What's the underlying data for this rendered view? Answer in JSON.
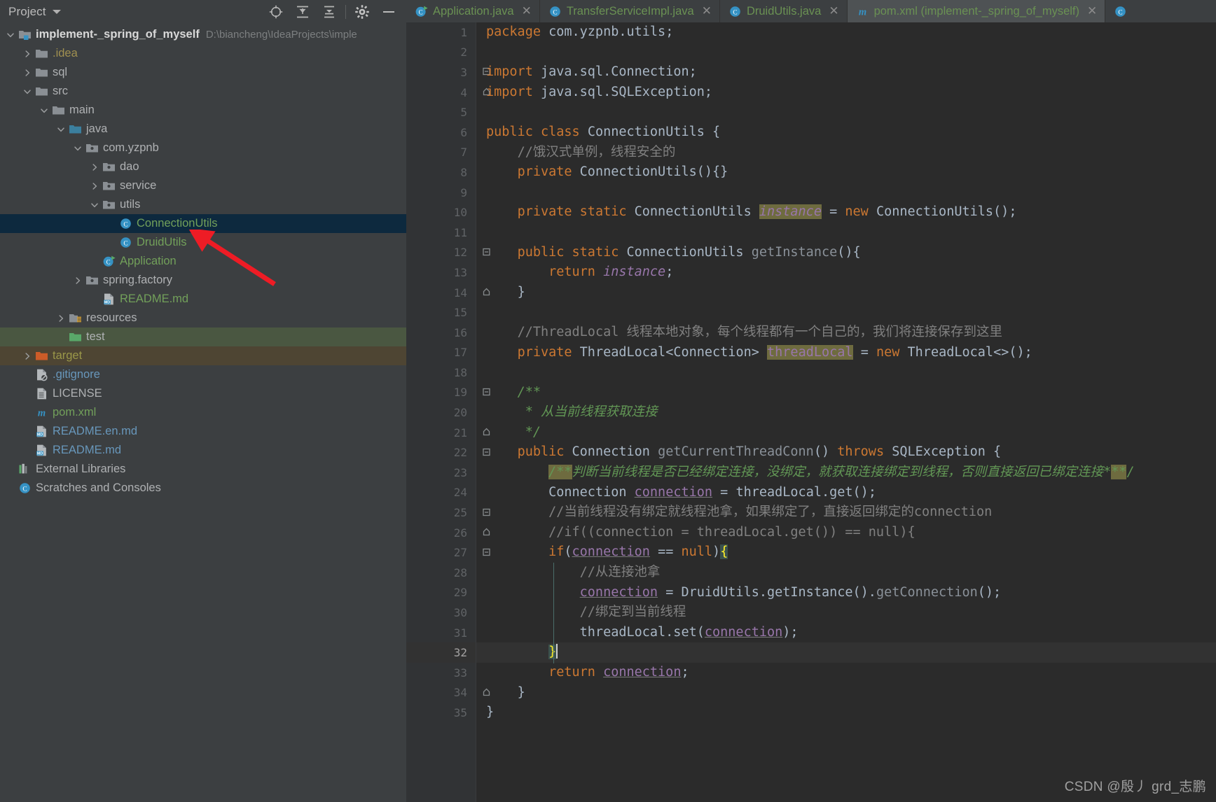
{
  "toolwindow": {
    "title": "Project",
    "actions": [
      {
        "name": "locate-icon",
        "tip": "Select Opened File"
      },
      {
        "name": "expand-all-icon",
        "tip": "Expand All"
      },
      {
        "name": "collapse-all-icon",
        "tip": "Collapse All"
      },
      {
        "name": "gear-icon",
        "tip": "Settings"
      },
      {
        "name": "minimize-icon",
        "tip": "Hide"
      }
    ]
  },
  "tree": [
    {
      "label": "implement-_spring_of_myself",
      "path": "D:\\biancheng\\IdeaProjects\\imple",
      "indent": 0,
      "arrow": "down",
      "icon": "module-icon",
      "color": "bold",
      "state": "normal"
    },
    {
      "label": ".idea",
      "indent": 1,
      "arrow": "right",
      "icon": "folder-icon",
      "color": "yellow",
      "state": "normal"
    },
    {
      "label": "sql",
      "indent": 1,
      "arrow": "right",
      "icon": "folder-icon",
      "color": "grey",
      "state": "normal"
    },
    {
      "label": "src",
      "indent": 1,
      "arrow": "down",
      "icon": "folder-icon",
      "color": "grey",
      "state": "normal"
    },
    {
      "label": "main",
      "indent": 2,
      "arrow": "down",
      "icon": "folder-icon",
      "color": "grey",
      "state": "normal"
    },
    {
      "label": "java",
      "indent": 3,
      "arrow": "down",
      "icon": "source-folder-icon",
      "color": "grey",
      "state": "normal"
    },
    {
      "label": "com.yzpnb",
      "indent": 4,
      "arrow": "down",
      "icon": "package-icon",
      "color": "grey",
      "state": "normal"
    },
    {
      "label": "dao",
      "indent": 5,
      "arrow": "right",
      "icon": "package-icon",
      "color": "grey",
      "state": "normal"
    },
    {
      "label": "service",
      "indent": 5,
      "arrow": "right",
      "icon": "package-icon",
      "color": "grey",
      "state": "normal"
    },
    {
      "label": "utils",
      "indent": 5,
      "arrow": "down",
      "icon": "package-icon",
      "color": "grey",
      "state": "normal"
    },
    {
      "label": "ConnectionUtils",
      "indent": 6,
      "arrow": "none",
      "icon": "java-class-icon",
      "color": "green",
      "state": "selected"
    },
    {
      "label": "DruidUtils",
      "indent": 6,
      "arrow": "none",
      "icon": "java-class-icon",
      "color": "green",
      "state": "normal"
    },
    {
      "label": "Application",
      "indent": 5,
      "arrow": "none",
      "icon": "java-runnable-class-icon",
      "color": "green",
      "state": "normal"
    },
    {
      "label": "spring.factory",
      "indent": 4,
      "arrow": "right",
      "icon": "package-icon",
      "color": "grey",
      "state": "normal"
    },
    {
      "label": "README.md",
      "indent": 5,
      "arrow": "none",
      "icon": "markdown-icon",
      "color": "green",
      "state": "normal"
    },
    {
      "label": "resources",
      "indent": 3,
      "arrow": "right",
      "icon": "resources-folder-icon",
      "color": "grey",
      "state": "normal"
    },
    {
      "label": "test",
      "indent": 3,
      "arrow": "none",
      "icon": "test-folder-icon",
      "color": "grey",
      "state": "green-bg"
    },
    {
      "label": "target",
      "indent": 1,
      "arrow": "right",
      "icon": "excluded-folder-icon",
      "color": "olive",
      "state": "brown-bg"
    },
    {
      "label": ".gitignore",
      "indent": 1,
      "arrow": "none",
      "icon": "gitignore-icon",
      "color": "blue",
      "state": "normal"
    },
    {
      "label": "LICENSE",
      "indent": 1,
      "arrow": "none",
      "icon": "text-file-icon",
      "color": "grey",
      "state": "normal"
    },
    {
      "label": "pom.xml",
      "indent": 1,
      "arrow": "none",
      "icon": "maven-icon",
      "color": "green",
      "state": "normal"
    },
    {
      "label": "README.en.md",
      "indent": 1,
      "arrow": "none",
      "icon": "markdown-icon",
      "color": "blue",
      "state": "normal"
    },
    {
      "label": "README.md",
      "indent": 1,
      "arrow": "none",
      "icon": "markdown-icon",
      "color": "blue",
      "state": "normal"
    },
    {
      "label": "External Libraries",
      "indent": 0,
      "arrow": "none",
      "icon": "libraries-icon",
      "color": "grey",
      "state": "normal"
    },
    {
      "label": "Scratches and Consoles",
      "indent": 0,
      "arrow": "none",
      "icon": "scratches-icon",
      "color": "grey",
      "state": "normal"
    }
  ],
  "tabs": [
    {
      "label": "Application.java",
      "icon": "java-runnable-class-icon",
      "active": false,
      "closable": true
    },
    {
      "label": "TransferServiceImpl.java",
      "icon": "java-class-icon",
      "active": false,
      "closable": true
    },
    {
      "label": "DruidUtils.java",
      "icon": "java-class-icon",
      "active": false,
      "closable": true
    },
    {
      "label": "pom.xml (implement-_spring_of_myself)",
      "icon": "maven-icon",
      "active": true,
      "closable": true
    },
    {
      "label": "",
      "icon": "java-class-icon",
      "active": false,
      "closable": false
    }
  ],
  "editor": {
    "current_line": 32,
    "line_numbers": [
      1,
      2,
      3,
      4,
      5,
      6,
      7,
      8,
      9,
      10,
      11,
      12,
      13,
      14,
      15,
      16,
      17,
      18,
      19,
      20,
      21,
      22,
      23,
      24,
      25,
      26,
      27,
      28,
      29,
      30,
      31,
      32,
      33,
      34,
      35
    ],
    "lines": [
      "package com.yzpnb.utils;",
      "",
      "import java.sql.Connection;",
      "import java.sql.SQLException;",
      "",
      "public class ConnectionUtils {",
      "    //饿汉式单例，线程安全的",
      "    private ConnectionUtils(){}",
      "",
      "    private static ConnectionUtils instance = new ConnectionUtils();",
      "",
      "    public static ConnectionUtils getInstance(){",
      "        return instance;",
      "    }",
      "",
      "    //ThreadLocal 线程本地对象，每个线程都有一个自己的，我们将连接保存到这里",
      "    private ThreadLocal<Connection> threadLocal = new ThreadLocal<>();",
      "",
      "    /**",
      "     * 从当前线程获取连接",
      "     */",
      "    public Connection getCurrentThreadConn() throws SQLException {",
      "        /**判断当前线程是否已经绑定连接，没绑定，就获取连接绑定到线程，否则直接返回已绑定连接**/",
      "        Connection connection = threadLocal.get();",
      "        //当前线程没有绑定就线程池拿，如果绑定了，直接返回绑定的connection",
      "        //if((connection = threadLocal.get()) == null){",
      "        if(connection == null){",
      "            //从连接池拿",
      "            connection = DruidUtils.getInstance().getConnection();",
      "            //绑定到当前线程",
      "            threadLocal.set(connection);",
      "        }",
      "        return connection;",
      "    }",
      "}"
    ]
  },
  "watermark": "CSDN @殷丿 grd_志鹏",
  "colors": {
    "sidebar_bg": "#3c3f41",
    "editor_bg": "#2b2b2b",
    "gutter_bg": "#313335",
    "selection_bg": "#0d293e",
    "keyword": "#cc7832",
    "comment": "#808080",
    "javadoc": "#629755",
    "field": "#9876aa",
    "text": "#a9b7c6",
    "accent_green": "#72a05a",
    "highlight": "#6e6b3f",
    "annotation_arrow": "#ee1c25"
  }
}
